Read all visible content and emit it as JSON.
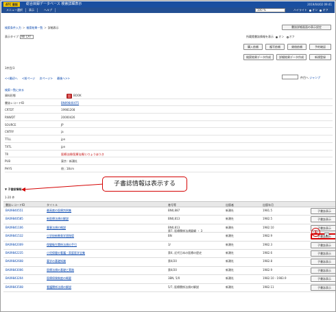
{
  "titlebar": {
    "brand": "ATC 書誌",
    "system_name": "総合目録データベース 検索詳細表示",
    "right_info": "2019/04/02 09:41"
  },
  "menu": {
    "items": [
      "メニュー選択",
      "表示",
      "ヘルプ"
    ],
    "zoom": "100 %",
    "contrast_label": "ハイライト",
    "contrast_on": "オン",
    "contrast_off": "オフ"
  },
  "breadcrumb": {
    "item1": "検索条件入力",
    "item2": "検索結果一覧",
    "current": "詳細表示"
  },
  "detail_help_button": "書誌詳細画面の表示設定",
  "view": {
    "label": "表示タイプ",
    "value": "NII CAT"
  },
  "lang": {
    "label": "所蔵館書誌情報を表示",
    "on": "オン",
    "off": "オフ"
  },
  "action_buttons": [
    "購入依頼",
    "複写依頼",
    "貸借依頼",
    "予約確認",
    "検索結果データ作成",
    "詳細結果データ作成",
    "新規登録"
  ],
  "result_count": "3件目/3",
  "pager": {
    "first": "<<最初へ",
    "prev": "<前ページ",
    "next": "次ページ>",
    "last": "最後へ>>"
  },
  "page_jump": {
    "suffix": "件目へ",
    "link": "ジャンプ"
  },
  "show_list_link": "検索一覧に戻る",
  "detail": [
    {
      "label": "資料形態",
      "value": "BOOK"
    },
    {
      "label": "書誌レコードID",
      "value": "BN09840475"
    },
    {
      "label": "CRTDT",
      "value": "19981208"
    },
    {
      "label": "RNWDT",
      "value": "20000426"
    },
    {
      "label": "SOURCE",
      "value": "JP"
    },
    {
      "label": "CNTRY",
      "value": "ja"
    },
    {
      "label": "TTLL",
      "value": "jpn"
    },
    {
      "label": "TXTL",
      "value": "jpn"
    },
    {
      "label": "TR",
      "value": "医療法規/医療法規/いりょうほうき"
    },
    {
      "label": "PUB",
      "value": "東京 : 新潮社"
    },
    {
      "label": "PHYS",
      "value": "冊 ; 18cm"
    }
  ],
  "children": {
    "header": "子書誌情報",
    "count": "1-20 件",
    "columns": {
      "id": "書誌レコードID",
      "title": "タイトル",
      "vol": "巻号等",
      "pub": "出版者",
      "year": "出版年月"
    },
    "button_label": "子書誌表示",
    "rows": [
      {
        "id": "BA09840551",
        "title": "最高裁の医療判例集",
        "vol": "BN0,887",
        "sub": "",
        "pub": "新潮社",
        "year": "1981.5"
      },
      {
        "id": "BA09840585",
        "title": "新医療法規の解説",
        "vol": "BN0,813",
        "sub": "",
        "pub": "新潮社",
        "year": "1982.5"
      },
      {
        "id": "BA09841106",
        "title": "薬事法規の概説",
        "vol": "BN0,813",
        "sub": "第7, 医療関係法規要綱 ・ 3",
        "pub": "新潮社",
        "year": "1982.10"
      },
      {
        "id": "BA09841532",
        "title": "小学校新教育学習指導",
        "vol": "BN",
        "sub": "",
        "pub": "新潮社",
        "year": "1982.9"
      },
      {
        "id": "BA09842009",
        "title": "保健衛生関係法規の手引",
        "vol": "3/",
        "sub": "",
        "pub": "新潮社",
        "year": "1982.3"
      },
      {
        "id": "BA09842235",
        "title": "小児保健の看護・家庭医学全集",
        "vol": "第4, 近代日本の医療の歴史",
        "sub": "",
        "pub": "新潮社",
        "year": "1982.6"
      },
      {
        "id": "BA09842608",
        "title": "薬学の基礎知識",
        "vol": "第4/20",
        "sub": "",
        "pub": "新潮社",
        "year": "1982.8"
      },
      {
        "id": "BA09843006",
        "title": "医療法規の基礎と実務",
        "vol": "第4/20",
        "sub": "",
        "pub": "新潮社",
        "year": "1982.9"
      },
      {
        "id": "BA09843204",
        "title": "医療保険制度の概要",
        "vol": "3BN, 5/0",
        "sub": "",
        "pub": "新潮社",
        "year": "1982.10 - 1983.9"
      },
      {
        "id": "BA09843508",
        "title": "看護関係法規の解説",
        "vol": "5/7, 医療関係法規の解説",
        "sub": "",
        "pub": "新潮社",
        "year": "1982.11"
      }
    ]
  },
  "annotations": {
    "callout": "子書誌情報は表示する",
    "circle": "①"
  }
}
